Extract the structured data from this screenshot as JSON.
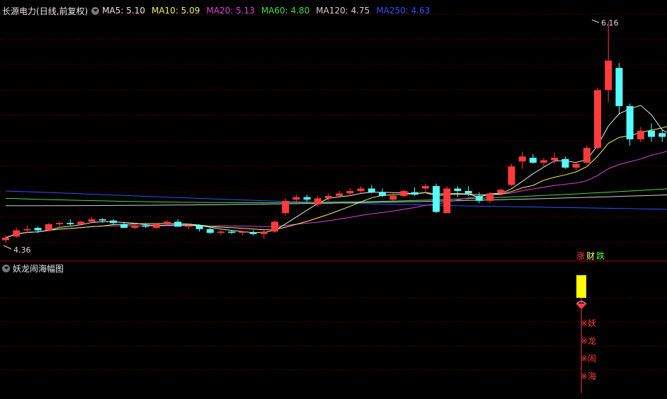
{
  "main_panel": {
    "header": {
      "stock_name": "长源电力",
      "period": "(日线,前复权)",
      "ma_items": [
        {
          "label": "MA5: 5.10",
          "color": "#e8e8e8"
        },
        {
          "label": "MA10: 5.09",
          "color": "#f2f25a"
        },
        {
          "label": "MA20: 5.13",
          "color": "#e040e0"
        },
        {
          "label": "MA60: 4.80",
          "color": "#40e040"
        },
        {
          "label": "MA120: 4.75",
          "color": "#d0d0d0"
        },
        {
          "label": "MA250: 4.63",
          "color": "#3050ff"
        }
      ]
    },
    "high_marker": "6.16",
    "low_marker": "4.36",
    "legend_tags": [
      {
        "text": "涨",
        "color": "#ff4040"
      },
      {
        "text": "财",
        "color": "#ffff40"
      },
      {
        "text": "跌",
        "color": "#40ff40"
      }
    ]
  },
  "sub_panel": {
    "title": "妖龙闹海幅图",
    "signal_labels": [
      "※妖",
      "※龙",
      "※闹",
      "※海"
    ]
  },
  "colors": {
    "up": "#ff3b3b",
    "down": "#54ffff",
    "grid": "#8b0000",
    "divider": "#b00000"
  },
  "chart_data": {
    "type": "candlestick",
    "price_range": [
      4.36,
      6.16
    ],
    "ohlc": [
      [
        4.38,
        4.42,
        4.36,
        4.4
      ],
      [
        4.41,
        4.48,
        4.4,
        4.46
      ],
      [
        4.46,
        4.5,
        4.44,
        4.47
      ],
      [
        4.48,
        4.49,
        4.44,
        4.46
      ],
      [
        4.46,
        4.52,
        4.45,
        4.51
      ],
      [
        4.51,
        4.53,
        4.49,
        4.52
      ],
      [
        4.52,
        4.55,
        4.5,
        4.51
      ],
      [
        4.51,
        4.54,
        4.5,
        4.53
      ],
      [
        4.53,
        4.57,
        4.52,
        4.55
      ],
      [
        4.55,
        4.56,
        4.52,
        4.54
      ],
      [
        4.54,
        4.55,
        4.51,
        4.52
      ],
      [
        4.51,
        4.53,
        4.49,
        4.48
      ],
      [
        4.48,
        4.52,
        4.47,
        4.5
      ],
      [
        4.5,
        4.52,
        4.48,
        4.49
      ],
      [
        4.48,
        4.52,
        4.47,
        4.51
      ],
      [
        4.51,
        4.54,
        4.5,
        4.53
      ],
      [
        4.53,
        4.55,
        4.5,
        4.49
      ],
      [
        4.49,
        4.51,
        4.47,
        4.5
      ],
      [
        4.5,
        4.51,
        4.45,
        4.47
      ],
      [
        4.47,
        4.48,
        4.43,
        4.44
      ],
      [
        4.44,
        4.46,
        4.42,
        4.45
      ],
      [
        4.45,
        4.46,
        4.43,
        4.44
      ],
      [
        4.44,
        4.46,
        4.42,
        4.45
      ],
      [
        4.44,
        4.46,
        4.42,
        4.43
      ],
      [
        4.43,
        4.46,
        4.39,
        4.45
      ],
      [
        4.45,
        4.54,
        4.44,
        4.53
      ],
      [
        4.6,
        4.72,
        4.58,
        4.7
      ],
      [
        4.71,
        4.75,
        4.68,
        4.73
      ],
      [
        4.73,
        4.75,
        4.69,
        4.71
      ],
      [
        4.67,
        4.74,
        4.65,
        4.72
      ],
      [
        4.72,
        4.76,
        4.7,
        4.74
      ],
      [
        4.74,
        4.78,
        4.73,
        4.76
      ],
      [
        4.76,
        4.8,
        4.74,
        4.78
      ],
      [
        4.78,
        4.82,
        4.76,
        4.8
      ],
      [
        4.8,
        4.83,
        4.76,
        4.77
      ],
      [
        4.77,
        4.8,
        4.73,
        4.74
      ],
      [
        4.71,
        4.76,
        4.7,
        4.74
      ],
      [
        4.74,
        4.79,
        4.73,
        4.78
      ],
      [
        4.77,
        4.81,
        4.74,
        4.75
      ],
      [
        4.8,
        4.84,
        4.76,
        4.82
      ],
      [
        4.82,
        4.84,
        4.6,
        4.61
      ],
      [
        4.6,
        4.82,
        4.6,
        4.8
      ],
      [
        4.8,
        4.82,
        4.73,
        4.78
      ],
      [
        4.78,
        4.82,
        4.74,
        4.76
      ],
      [
        4.74,
        4.77,
        4.68,
        4.7
      ],
      [
        4.7,
        4.77,
        4.68,
        4.76
      ],
      [
        4.76,
        4.8,
        4.75,
        4.79
      ],
      [
        4.83,
        5.0,
        4.82,
        4.98
      ],
      [
        5.02,
        5.1,
        4.96,
        5.06
      ],
      [
        5.05,
        5.08,
        5.0,
        5.01
      ],
      [
        5.01,
        5.05,
        4.98,
        5.03
      ],
      [
        5.03,
        5.09,
        5.0,
        5.05
      ],
      [
        5.04,
        5.06,
        4.96,
        4.97
      ],
      [
        4.97,
        5.02,
        4.95,
        5.0
      ],
      [
        5.01,
        5.15,
        5.0,
        5.13
      ],
      [
        5.13,
        5.62,
        5.12,
        5.6
      ],
      [
        5.6,
        6.16,
        5.5,
        5.84
      ],
      [
        5.78,
        5.82,
        5.4,
        5.47
      ],
      [
        5.47,
        5.49,
        5.15,
        5.2
      ],
      [
        5.2,
        5.3,
        5.18,
        5.27
      ],
      [
        5.27,
        5.33,
        5.18,
        5.22
      ],
      [
        5.25,
        5.28,
        5.18,
        5.22
      ],
      [
        5.22,
        5.28,
        5.2,
        5.25
      ]
    ]
  }
}
